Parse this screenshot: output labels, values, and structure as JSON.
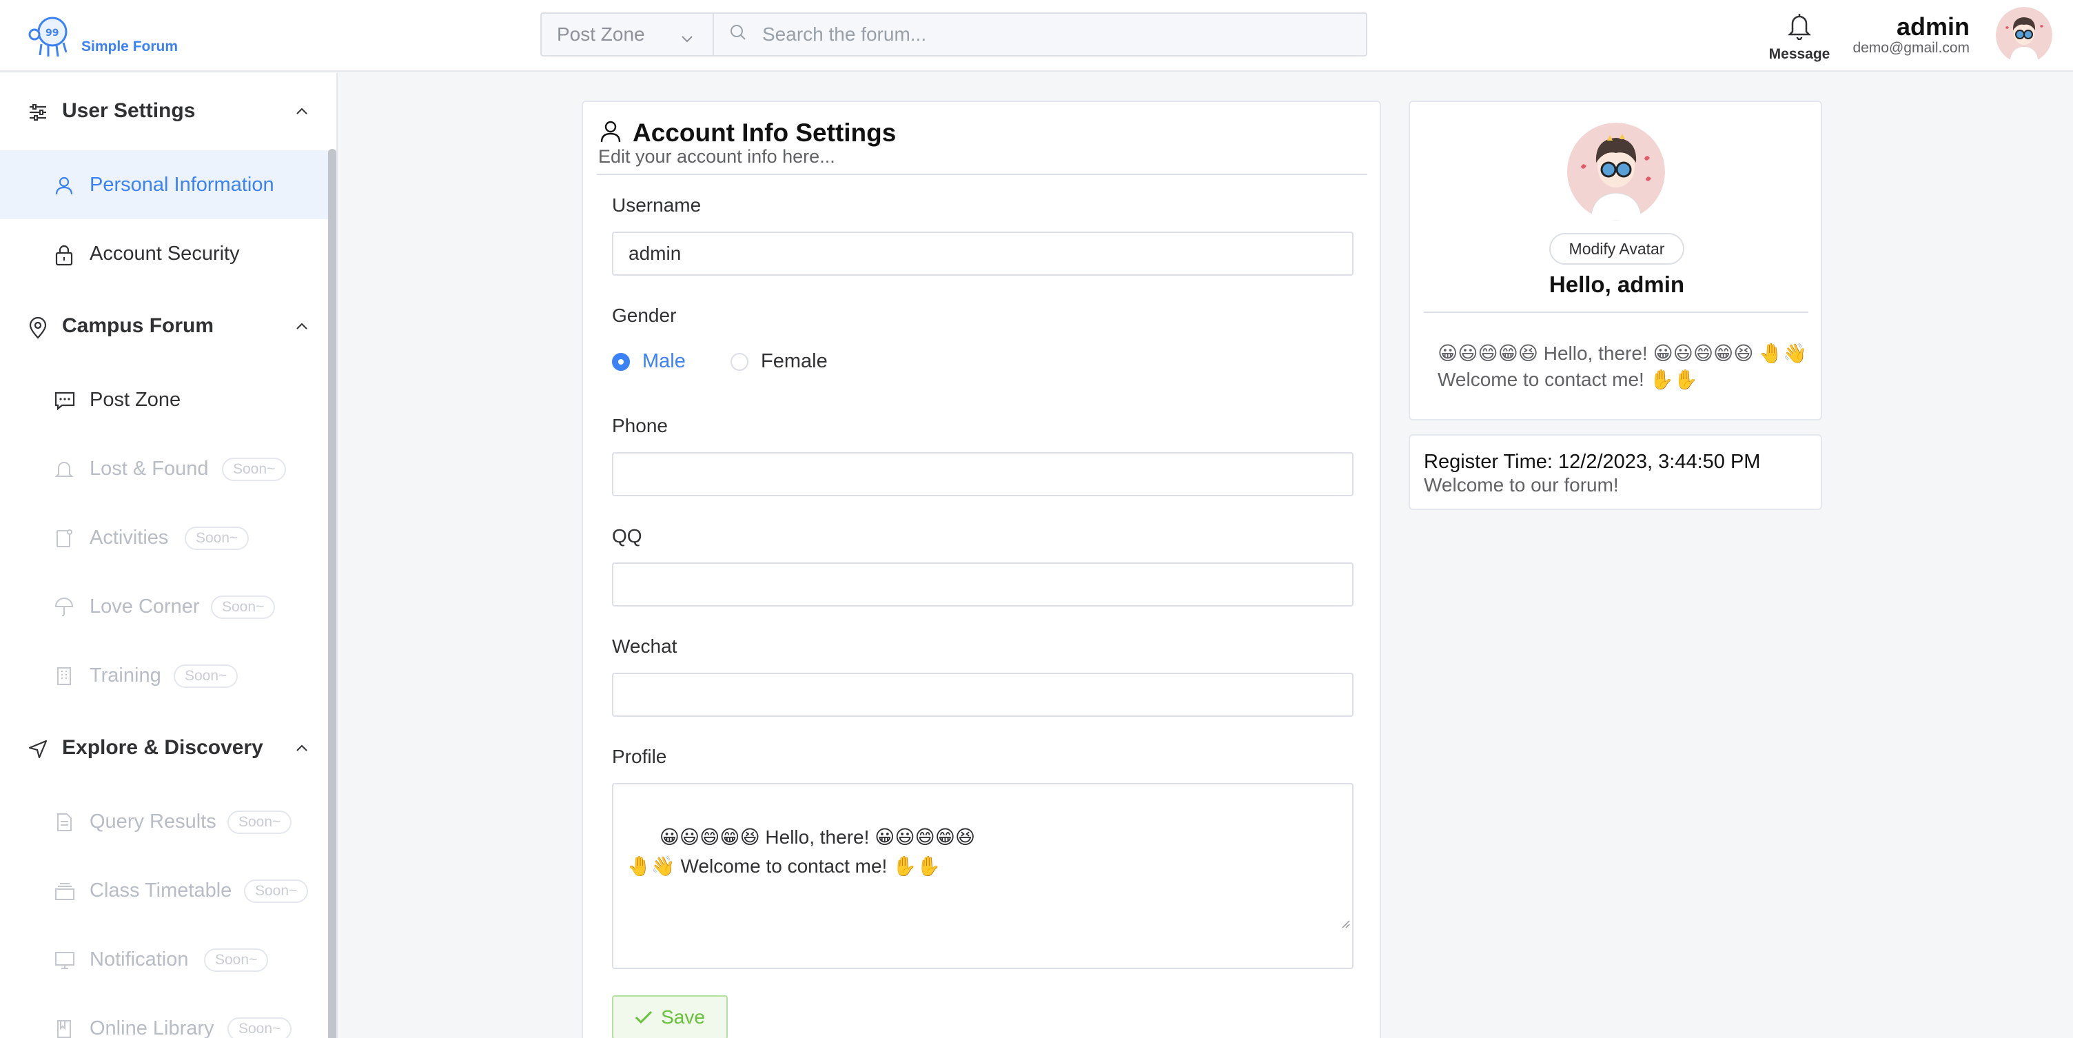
{
  "header": {
    "logo_text": "Simple Forum",
    "search_category": "Post Zone",
    "search_placeholder": "Search the forum...",
    "message_label": "Message",
    "user_name": "admin",
    "user_email": "demo@gmail.com"
  },
  "sidebar": {
    "groups": [
      {
        "title": "User Settings",
        "icon": "sliders-icon",
        "items": [
          {
            "label": "Personal Information",
            "icon": "user-icon",
            "active": true
          },
          {
            "label": "Account Security",
            "icon": "lock-icon"
          }
        ]
      },
      {
        "title": "Campus Forum",
        "icon": "location-pin-icon",
        "items": [
          {
            "label": "Post Zone",
            "icon": "chat-icon"
          },
          {
            "label": "Lost & Found",
            "icon": "bell-icon",
            "badge": "Soon~"
          },
          {
            "label": "Activities",
            "icon": "document-icon",
            "badge": "Soon~"
          },
          {
            "label": "Love Corner",
            "icon": "umbrella-icon",
            "badge": "Soon~"
          },
          {
            "label": "Training",
            "icon": "building-icon",
            "badge": "Soon~"
          }
        ]
      },
      {
        "title": "Explore & Discovery",
        "icon": "send-icon",
        "items": [
          {
            "label": "Query Results",
            "icon": "file-icon",
            "badge": "Soon~"
          },
          {
            "label": "Class Timetable",
            "icon": "stack-icon",
            "badge": "Soon~"
          },
          {
            "label": "Notification",
            "icon": "monitor-icon",
            "badge": "Soon~"
          },
          {
            "label": "Online Library",
            "icon": "book-icon",
            "badge": "Soon~"
          }
        ]
      }
    ]
  },
  "main": {
    "title": "Account Info Settings",
    "subtitle": "Edit your account info here...",
    "username_label": "Username",
    "username_value": "admin",
    "gender_label": "Gender",
    "gender_options": [
      "Male",
      "Female"
    ],
    "gender_selected": "Male",
    "phone_label": "Phone",
    "phone_value": "",
    "qq_label": "QQ",
    "qq_value": "",
    "wechat_label": "Wechat",
    "wechat_value": "",
    "profile_label": "Profile",
    "profile_value": "😀😃😄😁😆 Hello, there! 😀😃😄😁😆\n🤚👋 Welcome to contact me! ✋✋",
    "save_label": "Save"
  },
  "profile_card": {
    "modify_avatar_label": "Modify Avatar",
    "hello": "Hello, admin",
    "bio": "😀😃😄😁😆 Hello, there! 😀😃😄😁😆 🤚👋\nWelcome to contact me! ✋✋"
  },
  "register_card": {
    "register_time": "Register Time: 12/2/2023, 3:44:50 PM",
    "welcome": "Welcome to our forum!"
  },
  "colors": {
    "accent": "#3b82f6",
    "save_green": "#67c23a",
    "border": "#dcdfe6"
  }
}
